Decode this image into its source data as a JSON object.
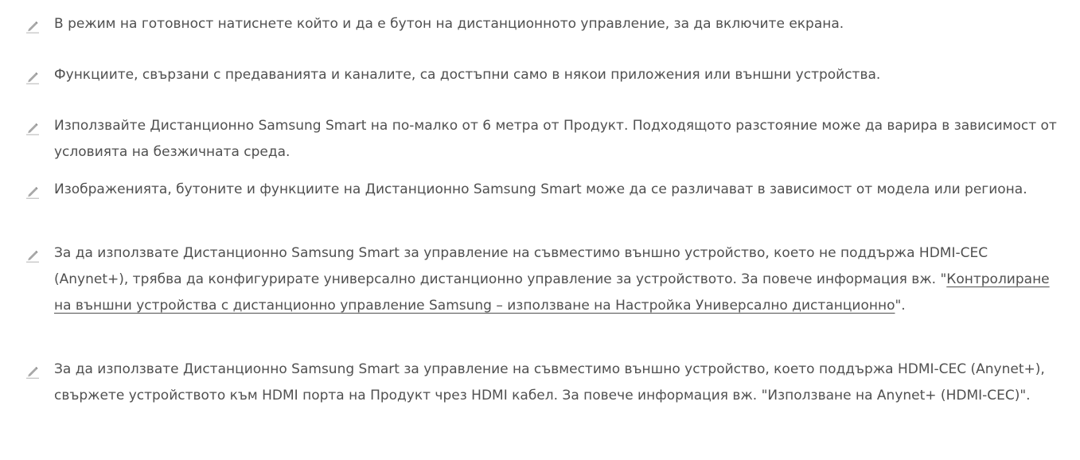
{
  "notes": [
    {
      "icon": "pencil-note-icon",
      "text": "В режим на готовност натиснете който и да е бутон на дистанционното управление, за да включите екрана."
    },
    {
      "icon": "pencil-note-icon",
      "text": "Функциите, свързани с предаванията и каналите, са достъпни само в някои приложения или външни устройства."
    },
    {
      "icon": "pencil-note-icon",
      "text": "Използвайте Дистанционно Samsung Smart на по-малко от 6 метра от Продукт. Подходящото разстояние може да варира в зависимост от условията на безжичната среда."
    },
    {
      "icon": "pencil-note-icon",
      "text": "Изображенията, бутоните и функциите на Дистанционно Samsung Smart може да се различават в зависимост от модела или региона."
    },
    {
      "icon": "pencil-note-icon",
      "text_before": "За да използвате Дистанционно Samsung Smart за управление на съвместимо външно устройство, което не поддържа HDMI-CEC (Anynet+), трябва да конфигурирате универсално дистанционно управление за устройството. За повече информация вж. \"",
      "link": "Контролиране на външни устройства с дистанционно управление Samsung – използване на Настройка Универсално дистанционно",
      "text_after": "\"."
    },
    {
      "icon": "pencil-note-icon",
      "text": "За да използвате Дистанционно Samsung Smart за управление на съвместимо външно устройство, което поддържа HDMI-CEC (Anynet+), свържете устройството към HDMI порта на Продукт чрез HDMI кабел. За повече информация вж. \"Използване на Anynet+ (HDMI-CEC)\"."
    }
  ]
}
